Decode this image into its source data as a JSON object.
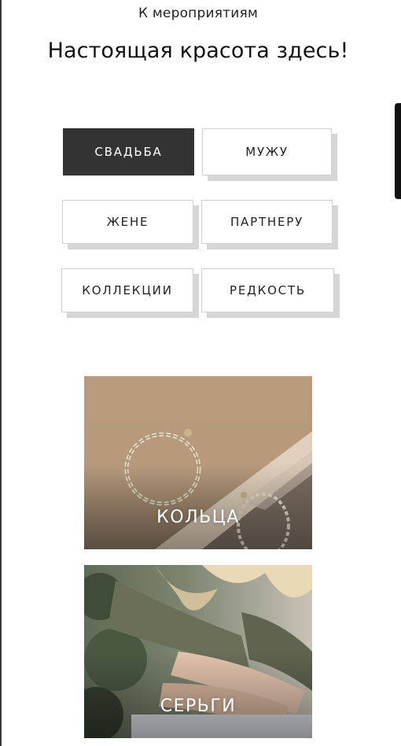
{
  "header": {
    "sublink": "К мероприятиям",
    "title": "Настоящая красота здесь!"
  },
  "filters": {
    "items": [
      {
        "label": "СВАДЬБА",
        "active": true
      },
      {
        "label": "МУЖУ",
        "active": false
      },
      {
        "label": "ЖЕНЕ",
        "active": false
      },
      {
        "label": "ПАРТНЕРУ",
        "active": false
      },
      {
        "label": "КОЛЛЕКЦИИ",
        "active": false
      },
      {
        "label": "РЕДКОСТЬ",
        "active": false
      }
    ]
  },
  "categories": [
    {
      "label": "КОЛЬЦА"
    },
    {
      "label": "СЕРЬГИ"
    }
  ],
  "colors": {
    "active_bg": "#333333",
    "tag_shadow": "#d6d6d6",
    "tag_border": "#cfcfcf"
  }
}
